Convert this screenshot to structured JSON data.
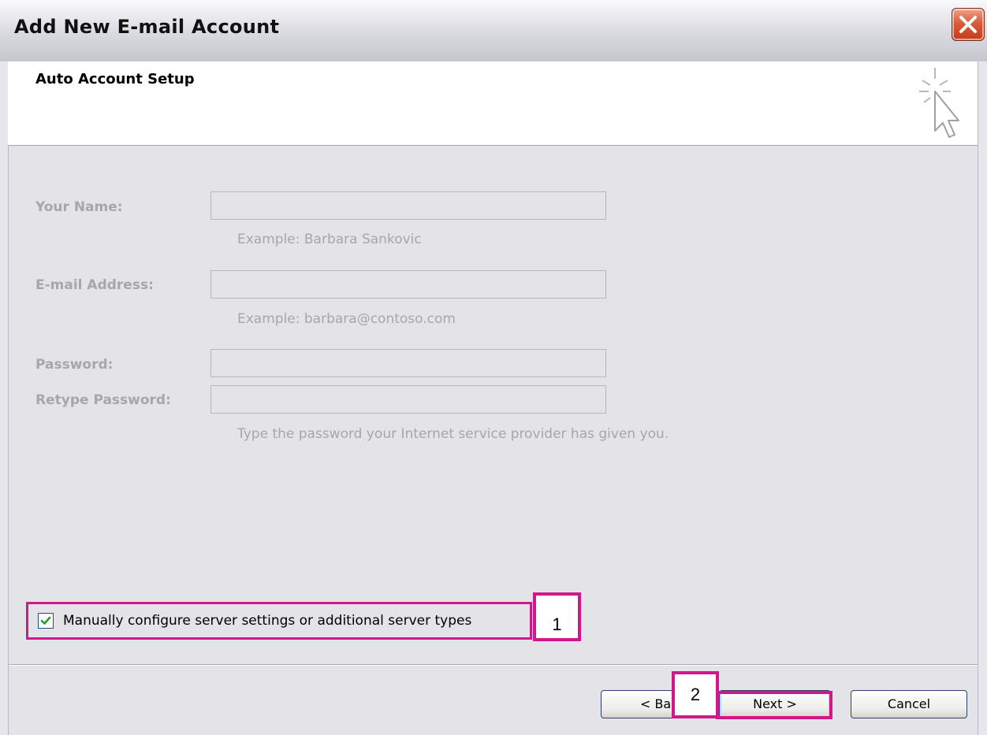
{
  "window": {
    "title": "Add New E-mail Account"
  },
  "header": {
    "title": "Auto Account Setup",
    "icon": "wizard-cursor-icon"
  },
  "form": {
    "your_name": {
      "label": "Your Name:",
      "value": "",
      "hint": "Example: Barbara Sankovic"
    },
    "email": {
      "label": "E-mail Address:",
      "value": "",
      "hint": "Example: barbara@contoso.com"
    },
    "password": {
      "label": "Password:",
      "value": ""
    },
    "retype_password": {
      "label": "Retype Password:",
      "value": ""
    },
    "password_hint": "Type the password your Internet service provider has given you."
  },
  "manual_config": {
    "label": "Manually configure server settings or additional server types",
    "checked": true
  },
  "annotations": {
    "badge1": "1",
    "badge2": "2",
    "highlight_color": "#d0188a"
  },
  "buttons": {
    "back": "< Bac",
    "next": "Next >",
    "cancel": "Cancel"
  },
  "colors": {
    "dialog_bg": "#e4e3e8",
    "disabled_text": "#a6a6ab",
    "close_button": "#d95b3a"
  }
}
